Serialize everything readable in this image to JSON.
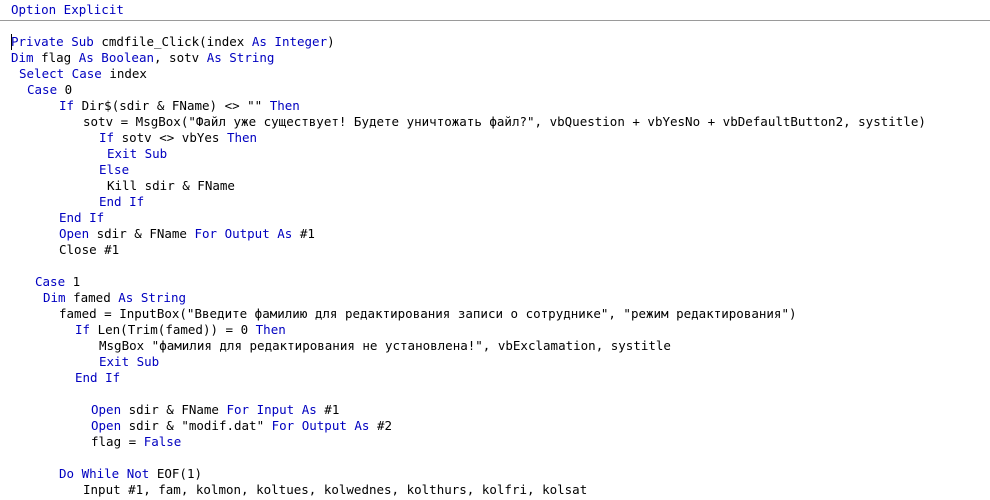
{
  "colors": {
    "keyword": "#0000c0",
    "text": "#000000",
    "background": "#ffffff",
    "separator": "#9a9a9a"
  },
  "code": {
    "declarations": [
      [
        [
          "kw",
          "Option Explicit"
        ]
      ]
    ],
    "lines": [
      [
        [
          "kw",
          "Private Sub"
        ],
        [
          "",
          " cmdfile_Click(index "
        ],
        [
          "kw",
          "As Integer"
        ],
        [
          "",
          ")"
        ]
      ],
      [
        [
          "kw",
          "Dim"
        ],
        [
          "",
          " flag "
        ],
        [
          "kw",
          "As Boolean"
        ],
        [
          "",
          ", sotv "
        ],
        [
          "kw",
          "As String"
        ]
      ],
      [
        [
          "kw",
          "Select Case"
        ],
        [
          "",
          " index"
        ]
      ],
      [
        [
          "kw",
          "Case"
        ],
        [
          "",
          " 0"
        ]
      ],
      [
        [
          "kw",
          "If"
        ],
        [
          "",
          " Dir$(sdir & FName) <> \"\" "
        ],
        [
          "kw",
          "Then"
        ]
      ],
      [
        [
          "",
          "sotv = MsgBox(\"Файл уже существует! Будете уничтожать файл?\", vbQuestion + vbYesNo + vbDefaultButton2, systitle)"
        ]
      ],
      [
        [
          "kw",
          "If"
        ],
        [
          "",
          " sotv <> vbYes "
        ],
        [
          "kw",
          "Then"
        ]
      ],
      [
        [
          "kw",
          "Exit Sub"
        ]
      ],
      [
        [
          "kw",
          "Else"
        ]
      ],
      [
        [
          "",
          "Kill sdir & FName"
        ]
      ],
      [
        [
          "kw",
          "End If"
        ]
      ],
      [
        [
          "kw",
          "End If"
        ]
      ],
      [
        [
          "kw",
          "Open"
        ],
        [
          "",
          " sdir & FName "
        ],
        [
          "kw",
          "For Output As"
        ],
        [
          "",
          " #1"
        ]
      ],
      [
        [
          "",
          "Close #1"
        ]
      ],
      [],
      [
        [
          "kw",
          "Case"
        ],
        [
          "",
          " 1"
        ]
      ],
      [
        [
          "kw",
          "Dim"
        ],
        [
          "",
          " famed "
        ],
        [
          "kw",
          "As String"
        ]
      ],
      [
        [
          "",
          "famed = InputBox(\"Введите фамилию для редактирования записи о сотруднике\", \"режим редактирования\")"
        ]
      ],
      [
        [
          "kw",
          "If"
        ],
        [
          "",
          " Len(Trim(famed)) = 0 "
        ],
        [
          "kw",
          "Then"
        ]
      ],
      [
        [
          "",
          "MsgBox \"фамилия для редактирования не установлена!\", vbExclamation, systitle"
        ]
      ],
      [
        [
          "kw",
          "Exit Sub"
        ]
      ],
      [
        [
          "kw",
          "End If"
        ]
      ],
      [],
      [
        [
          "kw",
          "Open"
        ],
        [
          "",
          " sdir & FName "
        ],
        [
          "kw",
          "For Input As"
        ],
        [
          "",
          " #1"
        ]
      ],
      [
        [
          "kw",
          "Open"
        ],
        [
          "",
          " sdir & \"modif.dat\" "
        ],
        [
          "kw",
          "For Output As"
        ],
        [
          "",
          " #2"
        ]
      ],
      [
        [
          "",
          "flag = "
        ],
        [
          "kw",
          "False"
        ]
      ],
      [],
      [
        [
          "kw",
          "Do While Not"
        ],
        [
          "",
          " EOF(1)"
        ]
      ],
      [
        [
          "",
          "Input #1, fam, kolmon, koltues, kolwednes, kolthurs, kolfri, kolsat"
        ]
      ]
    ]
  }
}
